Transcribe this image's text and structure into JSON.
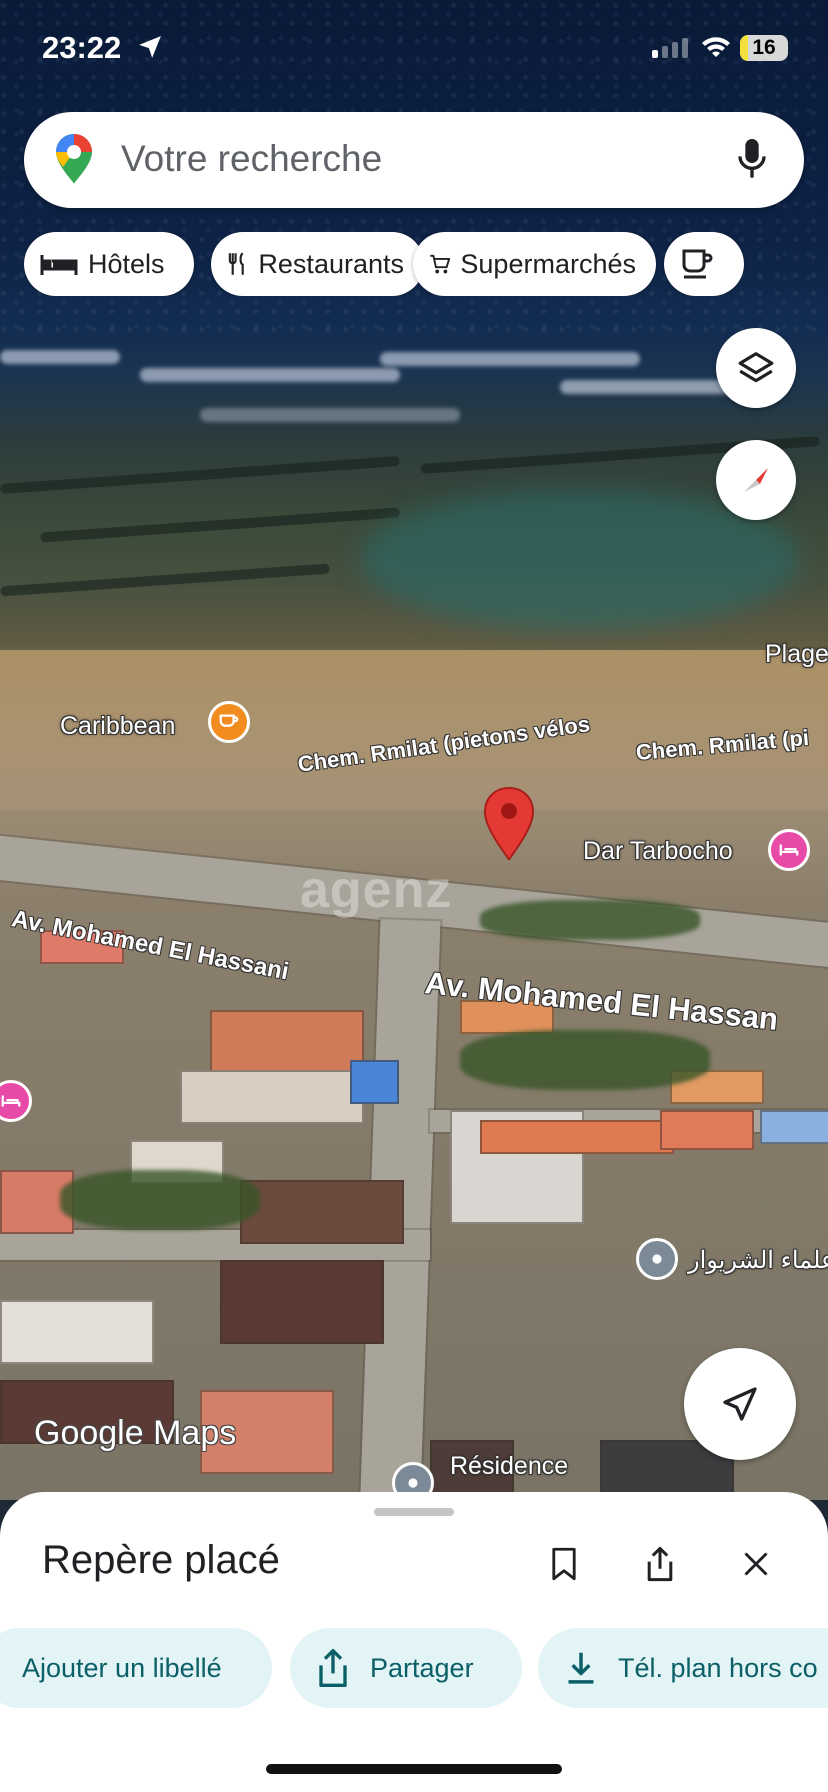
{
  "status_bar": {
    "time": "23:22",
    "battery": "16",
    "battery_level": 0.16
  },
  "search": {
    "placeholder": "Votre recherche",
    "icons": [
      "google-maps-pin-icon",
      "mic-icon"
    ]
  },
  "chips": [
    {
      "label": "Hôtels",
      "icon": "bed-icon"
    },
    {
      "label": "Restaurants",
      "icon": "fork-knife-icon"
    },
    {
      "label": "Supermarchés",
      "icon": "cart-icon"
    },
    {
      "label": "",
      "icon": "coffee-icon"
    }
  ],
  "map": {
    "labels": {
      "plage": "Plage",
      "caribbean": "Caribbean",
      "chem1": "Chem. Rmilat (pietons vélos",
      "chem2": "Chem. Rmilat (pi",
      "dar": "Dar Tarbocho",
      "av1": "Av. Mohamed El Hassani",
      "av2": "Av. Mohamed El Hassan",
      "arabic": "علماء الشريوار",
      "residence": "Résidence"
    },
    "watermark": "agenz",
    "google_logo": "Google Maps",
    "colors": {
      "pin": "#e53935",
      "cafe": "#f28c1e",
      "hotel": "#e84aa8"
    }
  },
  "sheet": {
    "title": "Repère placé",
    "icons": [
      "bookmark-icon",
      "share-icon",
      "close-icon"
    ],
    "actions": [
      {
        "label": "Ajouter un libellé",
        "icon": "label-icon"
      },
      {
        "label": "Partager",
        "icon": "share-icon"
      },
      {
        "label": "Tél. plan hors co",
        "icon": "download-icon"
      }
    ]
  }
}
